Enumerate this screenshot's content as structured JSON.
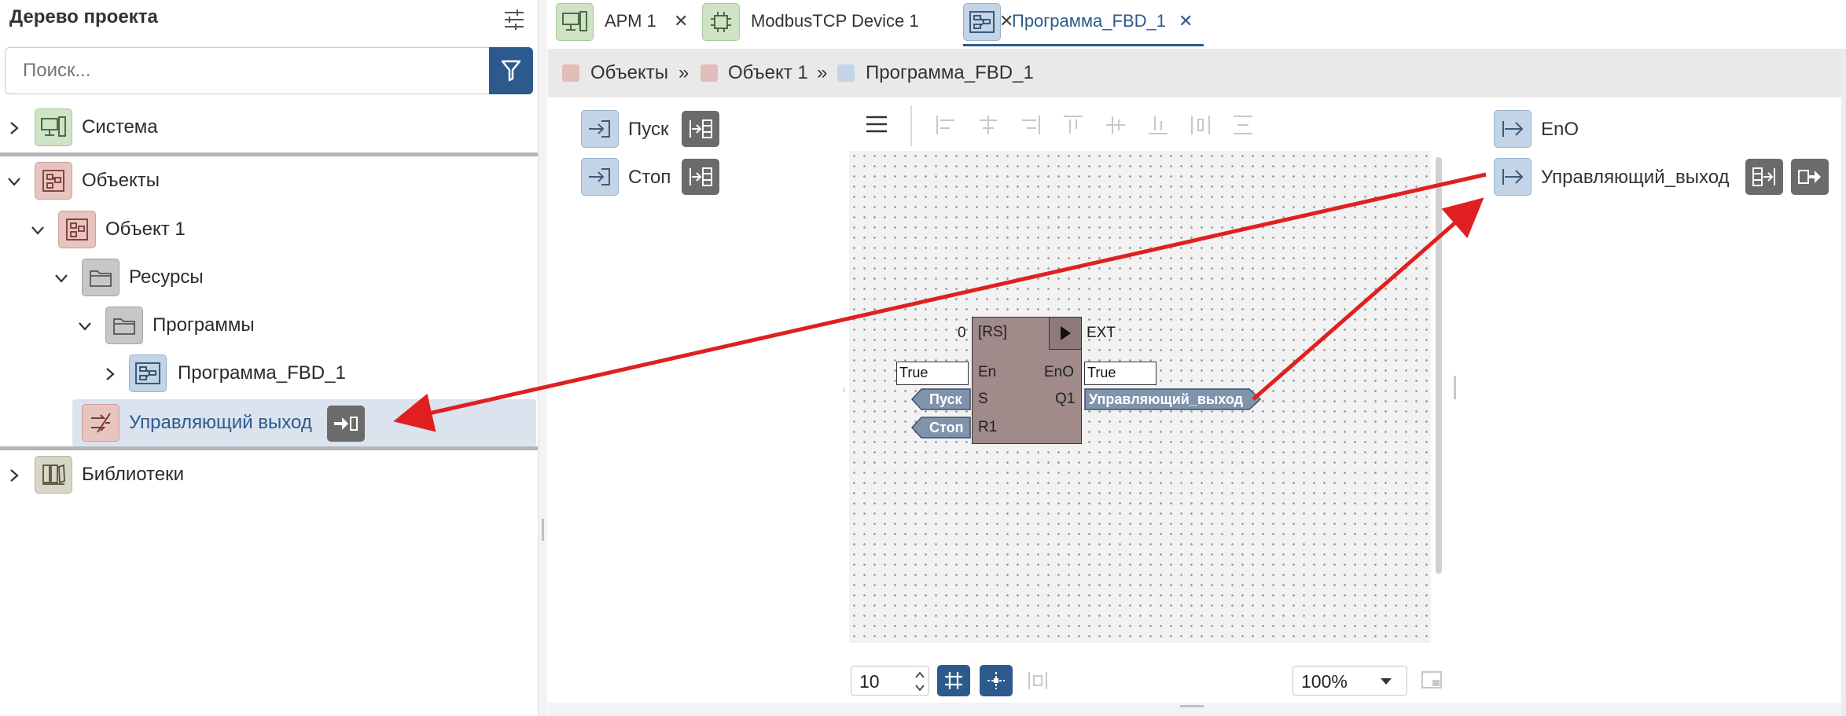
{
  "left_panel": {
    "title": "Дерево проекта",
    "search_placeholder": "Поиск...",
    "tree": [
      {
        "label": "Система",
        "icon": "computer-icon"
      },
      {
        "label": "Объекты",
        "icon": "objects-icon"
      },
      {
        "label": "Объект 1",
        "icon": "object-icon"
      },
      {
        "label": "Ресурсы",
        "icon": "folder-icon"
      },
      {
        "label": "Программы",
        "icon": "folder-icon"
      },
      {
        "label": "Программа_FBD_1",
        "icon": "fbd-program-icon"
      },
      {
        "label": "Управляющий выход",
        "icon": "output-icon"
      },
      {
        "label": "Библиотеки",
        "icon": "libraries-icon"
      }
    ]
  },
  "tabs": [
    {
      "label": "АРМ 1",
      "close": "✕"
    },
    {
      "label": "ModbusTCP Device 1",
      "close": "✕"
    },
    {
      "label": "Программа_FBD_1",
      "close": "✕"
    }
  ],
  "breadcrumb": {
    "items": [
      "Объекты",
      "Объект 1",
      "Программа_FBD_1"
    ],
    "separator": "»",
    "colors": [
      "#e0bdb8",
      "#e0bdb8",
      "#c2d4e6"
    ]
  },
  "inputs": [
    {
      "label": "Пуск"
    },
    {
      "label": "Стоп"
    }
  ],
  "outputs": [
    {
      "label": "EnO"
    },
    {
      "label": "Управляющий_выход"
    }
  ],
  "fbd_block": {
    "name": "[RS]",
    "left_value": "0",
    "ext_label": "EXT",
    "pins_left": [
      "En",
      "S",
      "R1"
    ],
    "pins_right": [
      "EnO",
      "Q1"
    ],
    "en_value": "True",
    "eno_value": "True",
    "s_input": "Пуск",
    "r1_input": "Стоп",
    "q1_output": "Управляющий_выход",
    "block_color": "#a08a8a"
  },
  "bottom_bar": {
    "grid_step": "10",
    "zoom": "100%"
  },
  "colors": {
    "accent": "#2d5a8c",
    "arrow": "#e02020",
    "tree_selected_bg": "#dbe3ee"
  }
}
